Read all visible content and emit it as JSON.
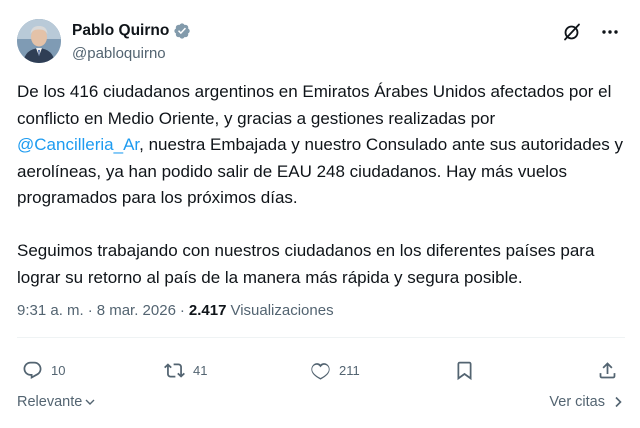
{
  "author": {
    "name": "Pablo Quirno",
    "handle": "@pabloquirno",
    "verified_color": "#829aab"
  },
  "post": {
    "paragraph1_part1": "De los 416 ciudadanos argentinos en Emiratos Árabes Unidos afectados por el conflicto en Medio Oriente, y gracias a gestiones realizadas por ",
    "mention": "@Cancilleria_Ar",
    "paragraph1_part2": ", nuestra Embajada y nuestro Consulado ante sus autoridades y aerolíneas, ya han podido salir de EAU 248 ciudadanos. Hay más vuelos programados para los próximos días.",
    "paragraph2": "Seguimos trabajando con nuestros ciudadanos en los diferentes países para lograr su retorno al país de la manera más rápida y segura posible."
  },
  "meta": {
    "time": "9:31 a. m.",
    "separator": "·",
    "date": "8 mar. 2026",
    "separator2": "·",
    "views_count": "2.417",
    "views_label": "Visualizaciones"
  },
  "actions": {
    "replies": "10",
    "reposts": "41",
    "likes": "211"
  },
  "footer": {
    "sort_label": "Relevante",
    "quotes_label": "Ver citas"
  },
  "colors": {
    "text": "#0f1419",
    "secondary": "#536471",
    "accent": "#1d9bf0"
  },
  "icons": [
    "verified-badge-icon",
    "grok-icon",
    "more-icon",
    "reply-icon",
    "repost-icon",
    "like-icon",
    "bookmark-icon",
    "share-icon",
    "chevron-down-icon",
    "chevron-right-icon"
  ]
}
